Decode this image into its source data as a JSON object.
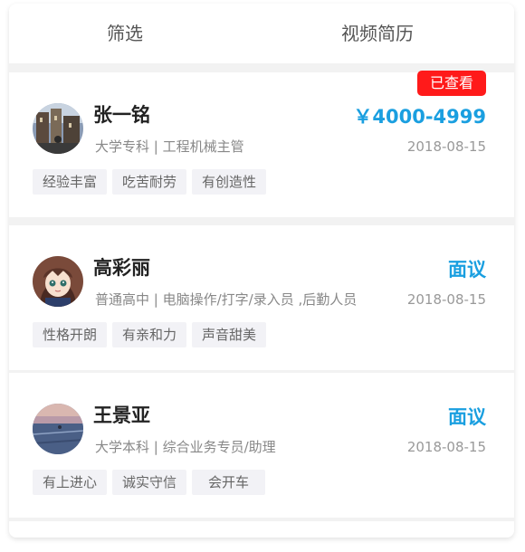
{
  "tabs": {
    "filter": "筛选",
    "video_resume": "视频简历"
  },
  "cards": [
    {
      "name": "张一铭",
      "education": "大学专科",
      "job": "工程机械主管",
      "salary": "￥4000-4999",
      "date": "2018-08-15",
      "badge": "已查看",
      "tags": [
        "经验丰富",
        "吃苦耐劳",
        "有创造性"
      ]
    },
    {
      "name": "高彩丽",
      "education": "普通高中",
      "job": "电脑操作/打字/录入员 ,后勤人员",
      "salary": "面议",
      "date": "2018-08-15",
      "tags": [
        "性格开朗",
        "有亲和力",
        "声音甜美"
      ]
    },
    {
      "name": "王景亚",
      "education": "大学本科",
      "job": "综合业务专员/助理",
      "salary": "面议",
      "date": "2018-08-15",
      "tags": [
        "有上进心",
        "诚实守信",
        "会开车"
      ]
    }
  ],
  "separator": " | ",
  "colors": {
    "accent": "#1a9fe0",
    "badge": "#ff1a1a",
    "tag_bg": "#f2f2f6"
  }
}
